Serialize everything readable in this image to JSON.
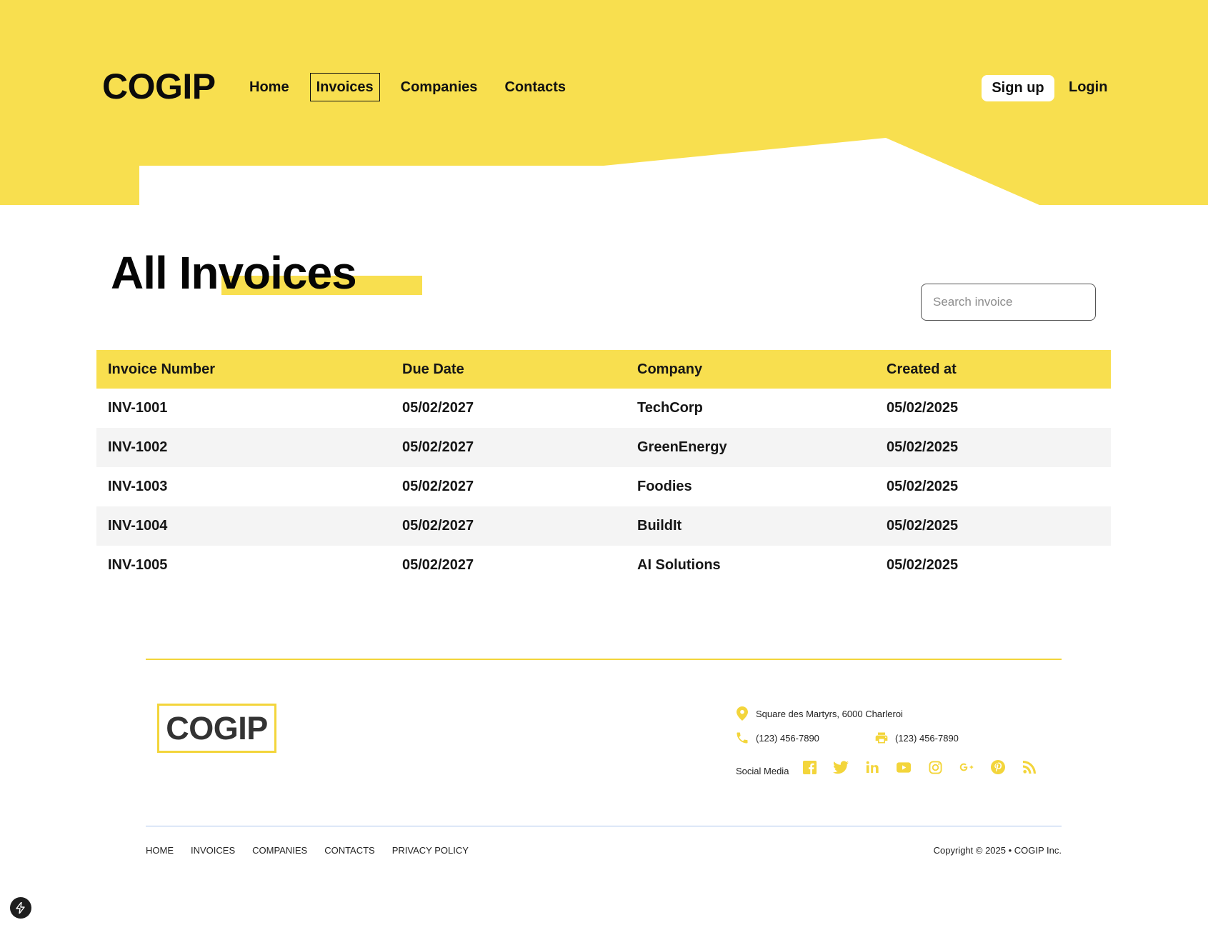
{
  "header": {
    "logo": "COGIP",
    "nav": [
      {
        "label": "Home",
        "active": false
      },
      {
        "label": "Invoices",
        "active": true
      },
      {
        "label": "Companies",
        "active": false
      },
      {
        "label": "Contacts",
        "active": false
      }
    ],
    "signup_label": "Sign up",
    "login_label": "Login"
  },
  "main": {
    "title": "All Invoices",
    "search": {
      "placeholder": "Search invoice",
      "value": ""
    },
    "table": {
      "headers": [
        "Invoice Number",
        "Due Date",
        "Company",
        "Created at"
      ],
      "rows": [
        [
          "INV-1001",
          "05/02/2027",
          "TechCorp",
          "05/02/2025"
        ],
        [
          "INV-1002",
          "05/02/2027",
          "GreenEnergy",
          "05/02/2025"
        ],
        [
          "INV-1003",
          "05/02/2027",
          "Foodies",
          "05/02/2025"
        ],
        [
          "INV-1004",
          "05/02/2027",
          "BuildIt",
          "05/02/2025"
        ],
        [
          "INV-1005",
          "05/02/2027",
          "AI Solutions",
          "05/02/2025"
        ]
      ]
    }
  },
  "footer": {
    "logo": "COGIP",
    "address": "Square des Martyrs, 6000 Charleroi",
    "phone": "(123) 456-7890",
    "fax": "(123) 456-7890",
    "social_label": "Social Media",
    "social_icons": [
      "facebook-icon",
      "twitter-icon",
      "linkedin-icon",
      "youtube-icon",
      "instagram-icon",
      "google-plus-icon",
      "pinterest-icon",
      "rss-icon"
    ],
    "nav": [
      "HOME",
      "INVOICES",
      "COMPANIES",
      "CONTACTS",
      "PRIVACY POLICY"
    ],
    "copyright": "Copyright © 2025 • COGIP Inc."
  },
  "colors": {
    "accent": "#f8df4f",
    "row_alt": "#f4f4f4",
    "footer_divider": "#a9c4ec"
  }
}
